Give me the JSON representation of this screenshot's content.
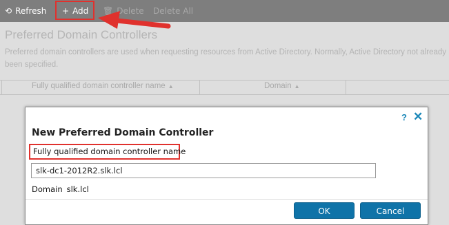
{
  "toolbar": {
    "refresh_label": "Refresh",
    "add_label": "Add",
    "delete_label": "Delete",
    "delete_all_label": "Delete All",
    "refresh_icon": "refresh-icon",
    "add_icon": "plus-icon",
    "delete_icon": "trash-icon"
  },
  "page": {
    "title": "Preferred Domain Controllers",
    "description": "Preferred domain controllers are used when requesting resources from Active Directory. Normally, Active Directory not already been specified.",
    "columns": [
      {
        "label": "Fully qualified domain controller name"
      },
      {
        "label": "Domain"
      }
    ]
  },
  "dialog": {
    "title": "New Preferred Domain Controller",
    "help_icon": "?",
    "close_icon": "✕",
    "fqdn_label": "Fully qualified domain controller name",
    "fqdn_value": "slk-dc1-2012R2.slk.lcl",
    "domain_label": "Domain",
    "domain_value": "slk.lcl",
    "ok_label": "OK",
    "cancel_label": "Cancel"
  },
  "colors": {
    "toolbar_bg": "#7e7e7e",
    "accent_blue": "#0f73a8",
    "annotation_red": "#e0312d"
  }
}
